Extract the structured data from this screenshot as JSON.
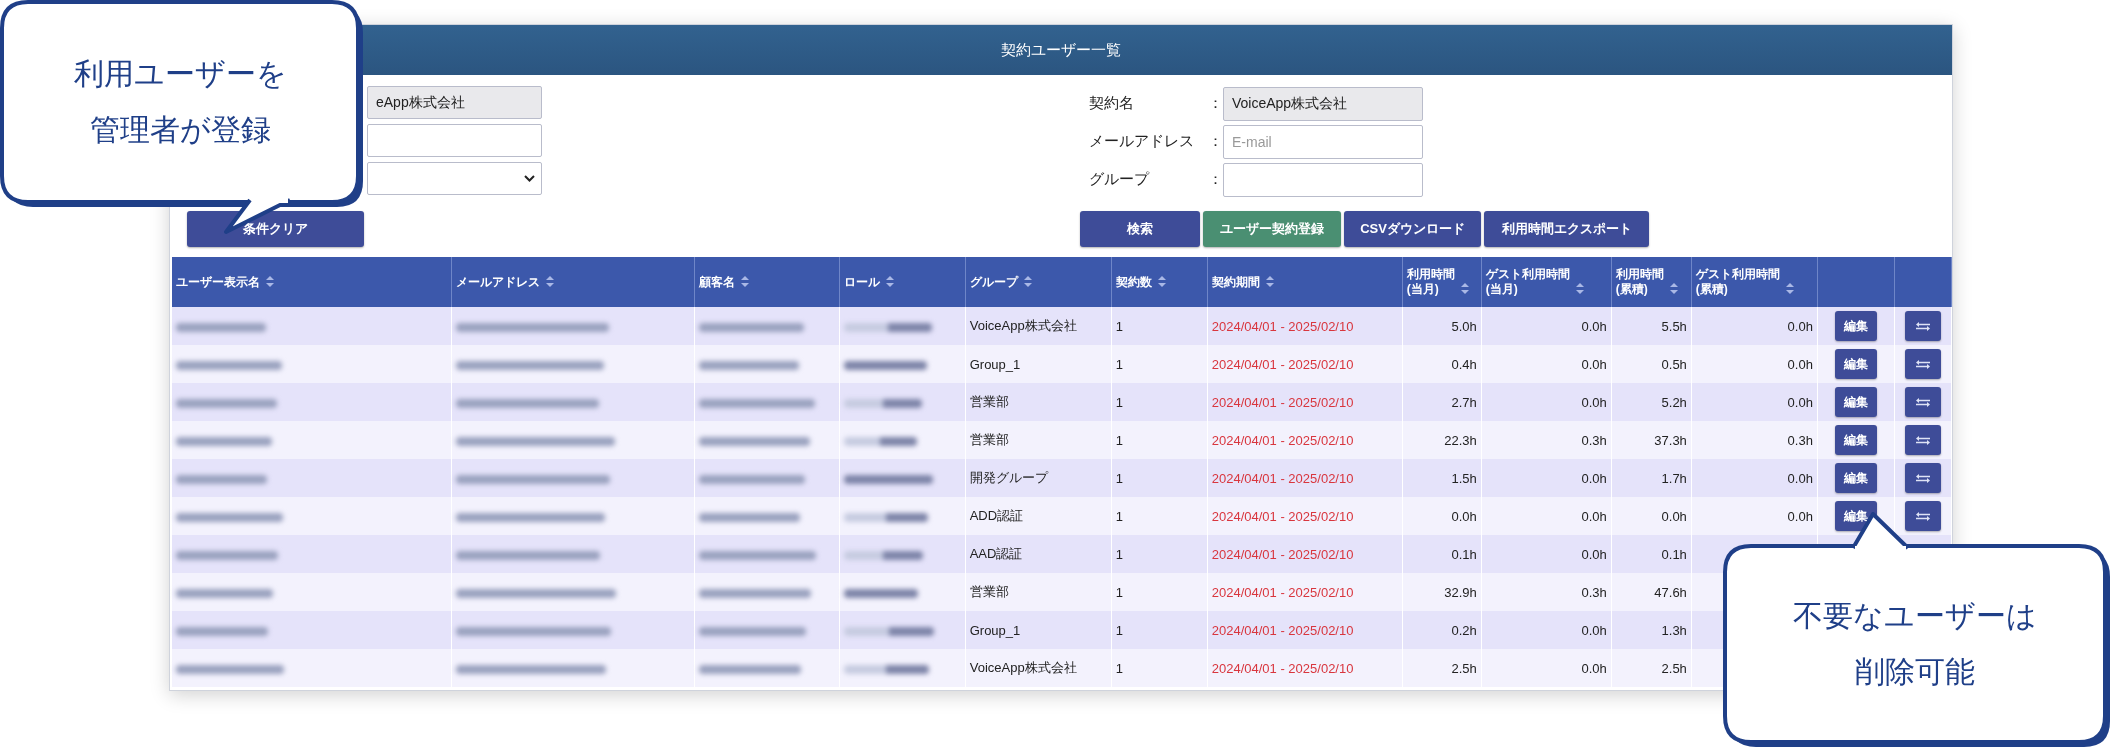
{
  "window": {
    "title": "契約ユーザー一覧"
  },
  "filters_left": {
    "contract_field": "eApp株式会社",
    "clear_button": "条件クリア"
  },
  "filters_right": [
    {
      "label": "契約名",
      "colon": "：",
      "value": "VoiceApp株式会社",
      "kind": "readonly"
    },
    {
      "label": "メールアドレス",
      "colon": "：",
      "placeholder": "E-mail",
      "kind": "input"
    },
    {
      "label": "グループ",
      "colon": "：",
      "kind": "input"
    }
  ],
  "buttons": [
    {
      "label": "検索",
      "kind": "primary"
    },
    {
      "label": "ユーザー契約登録",
      "kind": "success"
    },
    {
      "label": "CSVダウンロード",
      "kind": "primary"
    },
    {
      "label": "利用時間エクスポート",
      "kind": "primary"
    }
  ],
  "table": {
    "columns": [
      {
        "label": "ユーザー表示名",
        "sortable": true
      },
      {
        "label": "メールアドレス",
        "sortable": true
      },
      {
        "label": "顧客名",
        "sortable": true
      },
      {
        "label": "ロール",
        "sortable": true
      },
      {
        "label": "グループ",
        "sortable": true
      },
      {
        "label": "契約数",
        "sortable": true
      },
      {
        "label": "契約期間",
        "sortable": true
      },
      {
        "label": "利用時間\n(当月)",
        "sortable": true
      },
      {
        "label": "ゲスト利用時間\n(当月)",
        "sortable": true
      },
      {
        "label": "利用時間\n(累積)",
        "sortable": true
      },
      {
        "label": "ゲスト利用時間\n(累積)",
        "sortable": true
      },
      {
        "sortable": false
      },
      {
        "sortable": false
      }
    ],
    "rows": [
      {
        "group": "VoiceApp株式会社",
        "count": "1",
        "period": "2024/04/01 - 2025/02/10",
        "month": "5.0h",
        "guest_month": "0.0h",
        "total": "5.5h",
        "guest_total": "0.0h",
        "edit": "編集",
        "swap_button": true
      },
      {
        "group": "Group_1",
        "count": "1",
        "period": "2024/04/01 - 2025/02/10",
        "month": "0.4h",
        "guest_month": "0.0h",
        "total": "0.5h",
        "guest_total": "0.0h",
        "edit": "編集",
        "swap_button": true
      },
      {
        "group": "営業部",
        "count": "1",
        "period": "2024/04/01 - 2025/02/10",
        "month": "2.7h",
        "guest_month": "0.0h",
        "total": "5.2h",
        "guest_total": "0.0h",
        "edit": "編集",
        "swap_button": true
      },
      {
        "group": "営業部",
        "count": "1",
        "period": "2024/04/01 - 2025/02/10",
        "month": "22.3h",
        "guest_month": "0.3h",
        "total": "37.3h",
        "guest_total": "0.3h",
        "edit": "編集",
        "swap_button": true
      },
      {
        "group": "開発グループ",
        "count": "1",
        "period": "2024/04/01 - 2025/02/10",
        "month": "1.5h",
        "guest_month": "0.0h",
        "total": "1.7h",
        "guest_total": "0.0h",
        "edit": "編集",
        "swap_button": true
      },
      {
        "group": "ADD認証",
        "count": "1",
        "period": "2024/04/01 - 2025/02/10",
        "month": "0.0h",
        "guest_month": "0.0h",
        "total": "0.0h",
        "guest_total": "0.0h",
        "edit": "編集",
        "swap_button": true
      },
      {
        "group": "AAD認証",
        "count": "1",
        "period": "2024/04/01 - 2025/02/10",
        "month": "0.1h",
        "guest_month": "0.0h",
        "total": "0.1h"
      },
      {
        "group": "営業部",
        "count": "1",
        "period": "2024/04/01 - 2025/02/10",
        "month": "32.9h",
        "guest_month": "0.3h",
        "total": "47.6h"
      },
      {
        "group": "Group_1",
        "count": "1",
        "period": "2024/04/01 - 2025/02/10",
        "month": "0.2h",
        "guest_month": "0.0h",
        "total": "1.3h"
      },
      {
        "group": "VoiceApp株式会社",
        "count": "1",
        "period": "2024/04/01 - 2025/02/10",
        "month": "2.5h",
        "guest_month": "0.0h",
        "total": "2.5h"
      }
    ]
  },
  "callouts": [
    {
      "lines": [
        "利用ユーザーを",
        "管理者が登録"
      ]
    },
    {
      "lines": [
        "不要なユーザーは",
        "削除可能"
      ]
    }
  ]
}
